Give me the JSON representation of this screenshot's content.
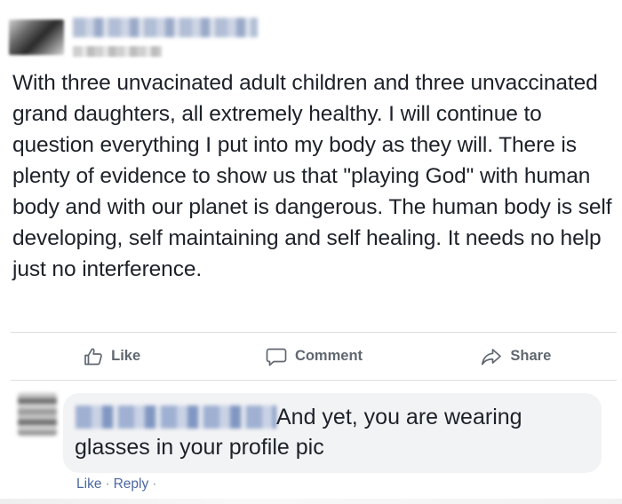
{
  "post": {
    "author_name": "",
    "timestamp": "",
    "text": "With three unvacinated adult children and three unvaccinated grand daughters, all extremely healthy. I will continue to question everything I put into my body as they will. There is plenty of evidence to show us that \"playing God\" with human body and with our planet is dangerous. The human body is self developing, self maintaining and self healing. It needs no help just no interference."
  },
  "actions": {
    "like_label": "Like",
    "comment_label": "Comment",
    "share_label": "Share"
  },
  "comment": {
    "author_name": "",
    "text": "And yet, you are wearing glasses in your profile pic",
    "like_label": "Like",
    "reply_label": "Reply",
    "separator": "·"
  },
  "icons": {
    "like": "thumbs-up-icon",
    "comment": "speech-bubble-icon",
    "share": "share-arrow-icon"
  },
  "colors": {
    "action_text": "#606770",
    "link": "#4b67a1",
    "bubble_bg": "#f2f3f5",
    "divider": "#dadde1",
    "body_text": "#1d2129"
  }
}
